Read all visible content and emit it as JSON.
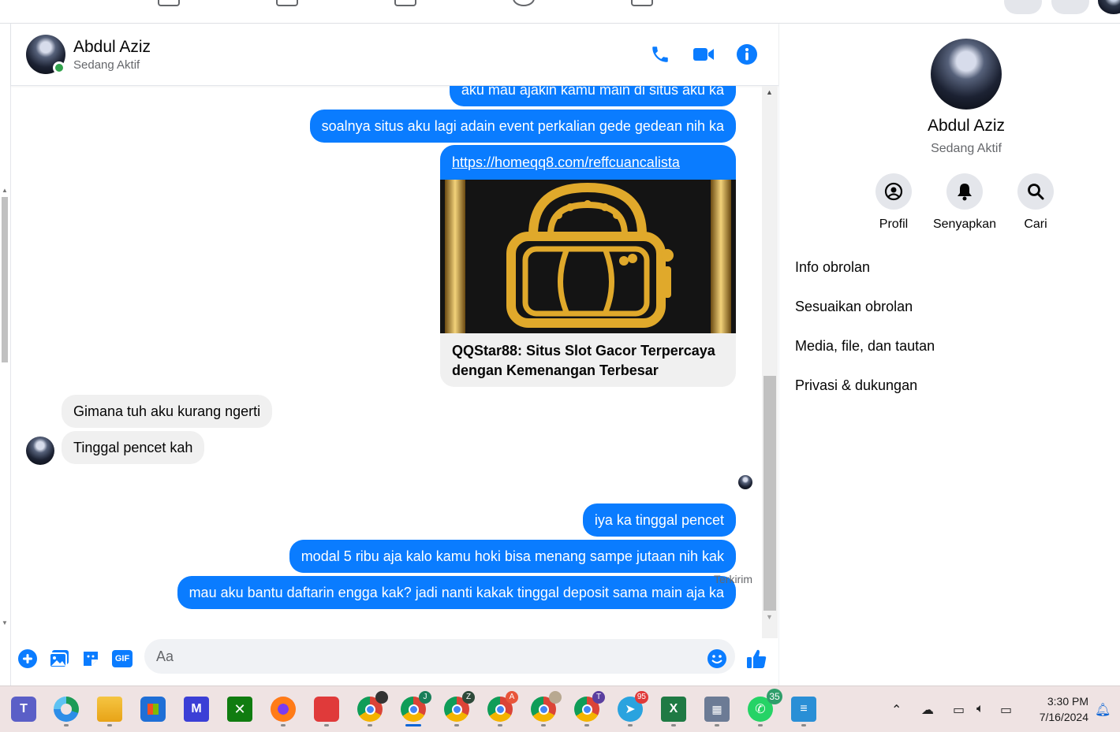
{
  "conversation": {
    "contact_name": "Abdul Aziz",
    "status": "Sedang Aktif"
  },
  "messages": {
    "out_1": "aku mau ajakin kamu main di situs aku ka",
    "out_2": "soalnya situs aku lagi adain event perkalian gede gedean nih ka",
    "link_url": "https://homeqq8.com/reffcuancalista",
    "link_title": "QQStar88: Situs Slot Gacor Terpercaya dengan Kemenangan Terbesar",
    "in_1": "Gimana tuh aku kurang ngerti",
    "in_2": "Tinggal pencet kah",
    "out_3": "iya ka tinggal pencet",
    "out_4": "modal 5 ribu aja kalo kamu hoki bisa menang sampe jutaan nih kak",
    "out_5": "mau aku bantu daftarin engga kak? jadi nanti kakak tinggal deposit sama main aja ka",
    "sent_status": "Terkirim"
  },
  "composer": {
    "placeholder": "Aa",
    "gif_label": "GIF"
  },
  "info_panel": {
    "name": "Abdul Aziz",
    "status": "Sedang Aktif",
    "actions": [
      {
        "label": "Profil",
        "icon": "profile-icon"
      },
      {
        "label": "Senyapkan",
        "icon": "bell-icon"
      },
      {
        "label": "Cari",
        "icon": "search-icon"
      }
    ],
    "menu": [
      "Info obrolan",
      "Sesuaikan obrolan",
      "Media, file, dan tautan",
      "Privasi & dukungan"
    ]
  },
  "taskbar": {
    "time": "3:30 PM",
    "date": "7/16/2024",
    "badges": {
      "telegram": "95",
      "whatsapp": "35",
      "chrome_j": "J",
      "chrome_z": "Z",
      "chrome_a": "A",
      "chrome_t": "T"
    }
  },
  "colors": {
    "messenger_blue": "#0a7cff",
    "online_green": "#31a24c",
    "incoming_bubble": "#f0f0f0"
  }
}
